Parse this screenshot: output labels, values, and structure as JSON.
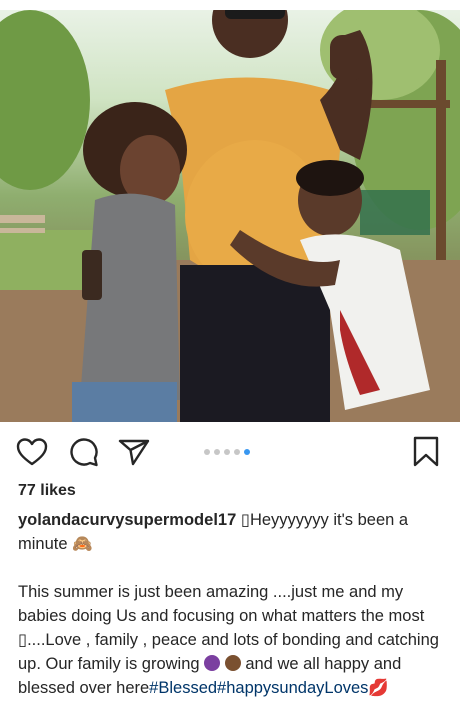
{
  "post": {
    "likes_text": "77 likes",
    "username": "yolandacurvysupermodel17",
    "caption_line1": "▯Heyyyyyyy it's been a minute",
    "caption_emoji1": "🙈",
    "caption_p2_a": "This summer is just been amazing ....just  me and my babies doing Us and focusing on what matters the most ▯....Love , family , peace and lots of bonding and catching up. Our family is growing ",
    "caption_p2_b": " and we all happy and blessed over here",
    "hashtags": "#Blessed#happysundayLoves",
    "caption_emoji_end": "💋"
  },
  "carousel": {
    "count": 5,
    "active_index": 4
  },
  "colors": {
    "accent": "#3897f0",
    "hashtag": "#003569",
    "text": "#262626"
  },
  "icons": [
    "heart-icon",
    "comment-icon",
    "share-icon",
    "bookmark-icon"
  ]
}
